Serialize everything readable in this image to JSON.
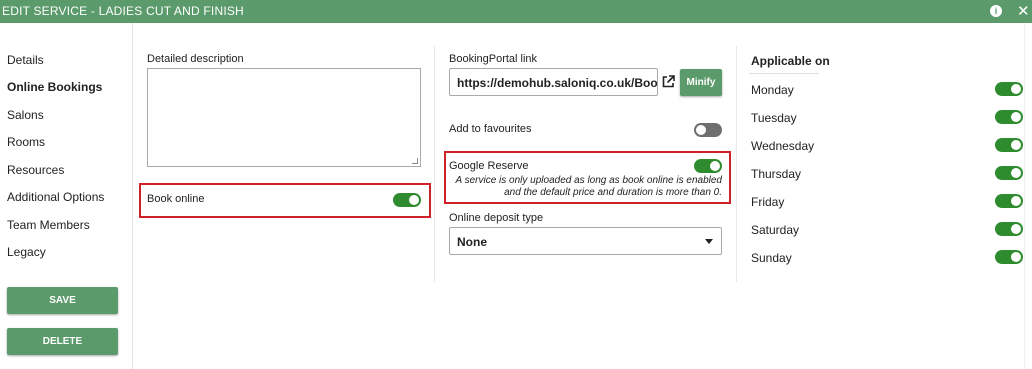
{
  "titlebar": {
    "title": "EDIT SERVICE - LADIES CUT AND FINISH",
    "info_icon": "i",
    "close_icon": "✕"
  },
  "sidebar": {
    "items": [
      {
        "label": "Details"
      },
      {
        "label": "Online Bookings",
        "active": true
      },
      {
        "label": "Salons"
      },
      {
        "label": "Rooms"
      },
      {
        "label": "Resources"
      },
      {
        "label": "Additional Options"
      },
      {
        "label": "Team Members"
      },
      {
        "label": "Legacy"
      }
    ],
    "save_label": "SAVE",
    "delete_label": "DELETE"
  },
  "left_panel": {
    "description_label": "Detailed description",
    "description_value": "",
    "book_online_label": "Book online",
    "book_online_on": true
  },
  "middle_panel": {
    "booking_portal_label": "BookingPortal link",
    "booking_portal_value": "https://demohub.saloniq.co.uk/Bookin",
    "minify_label": "Minify",
    "favourites_label": "Add to favourites",
    "favourites_on": false,
    "google_reserve_label": "Google Reserve",
    "google_reserve_on": true,
    "google_reserve_note_line1": "A service is only uploaded as long as book online is enabled",
    "google_reserve_note_line2": "and the default price and duration is more than 0.",
    "deposit_label": "Online deposit type",
    "deposit_value": "None"
  },
  "applicable": {
    "title": "Applicable on",
    "days": [
      {
        "label": "Monday",
        "on": true
      },
      {
        "label": "Tuesday",
        "on": true
      },
      {
        "label": "Wednesday",
        "on": true
      },
      {
        "label": "Thursday",
        "on": true
      },
      {
        "label": "Friday",
        "on": true
      },
      {
        "label": "Saturday",
        "on": true
      },
      {
        "label": "Sunday",
        "on": true
      }
    ]
  },
  "colors": {
    "brand_green": "#5b9a6b",
    "toggle_on": "#2e8b2e",
    "toggle_off": "#6f6f6f",
    "highlight_red": "#d0202a"
  }
}
